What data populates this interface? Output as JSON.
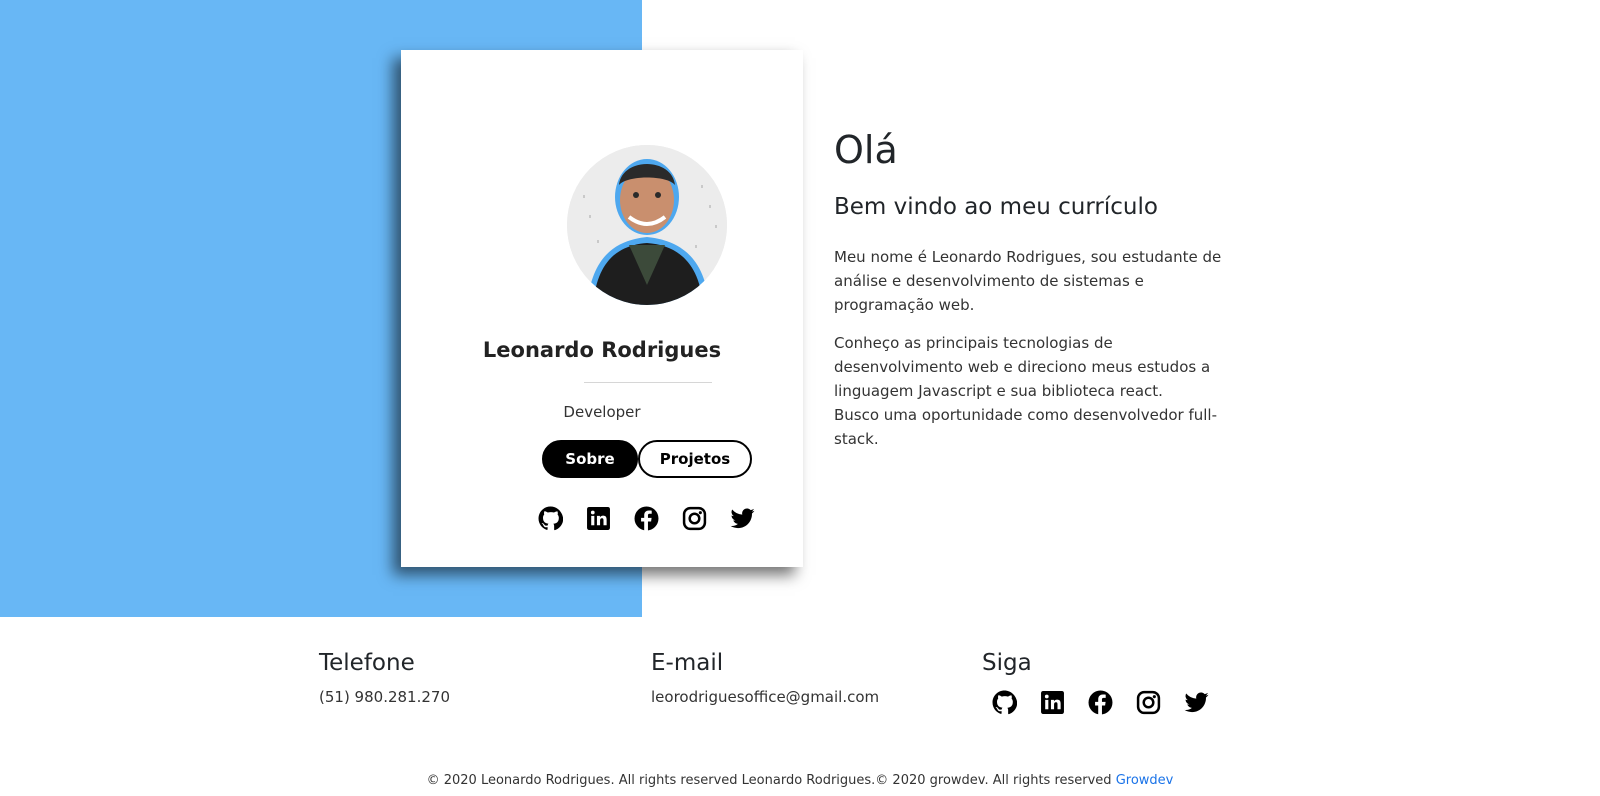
{
  "card": {
    "name": "Leonardo Rodrigues",
    "role": "Developer",
    "buttons": {
      "about": "Sobre",
      "projects": "Projetos"
    },
    "social_icons": [
      "github-icon",
      "linkedin-icon",
      "facebook-icon",
      "instagram-icon",
      "twitter-icon"
    ]
  },
  "intro": {
    "title": "Olá",
    "subtitle": "Bem vindo ao meu currículo",
    "paragraph1": "Meu nome é Leonardo Rodrigues, sou estudante de análise e desenvolvimento de sistemas e programação web.",
    "paragraph2_line1": "Conheço as principais tecnologias de desenvolvimento web e direciono meus estudos a linguagem Javascript e sua biblioteca react.",
    "paragraph2_line2": "Busco uma oportunidade como desenvolvedor full-stack."
  },
  "footer": {
    "phone_heading": "Telefone",
    "phone": "(51) 980.281.270",
    "email_heading": "E-mail",
    "email": "leorodriguesoffice@gmail.com",
    "follow_heading": "Siga",
    "social_icons": [
      "github-icon",
      "linkedin-icon",
      "facebook-icon",
      "instagram-icon",
      "twitter-icon"
    ]
  },
  "copyright": {
    "text": "© 2020 Leonardo Rodrigues. All rights reserved Leonardo Rodrigues.© 2020 growdev. All rights reserved",
    "link": "Growdev"
  },
  "colors": {
    "accent_blue": "#68b7f5",
    "link": "#1a73e8",
    "button_primary": "#000000"
  }
}
